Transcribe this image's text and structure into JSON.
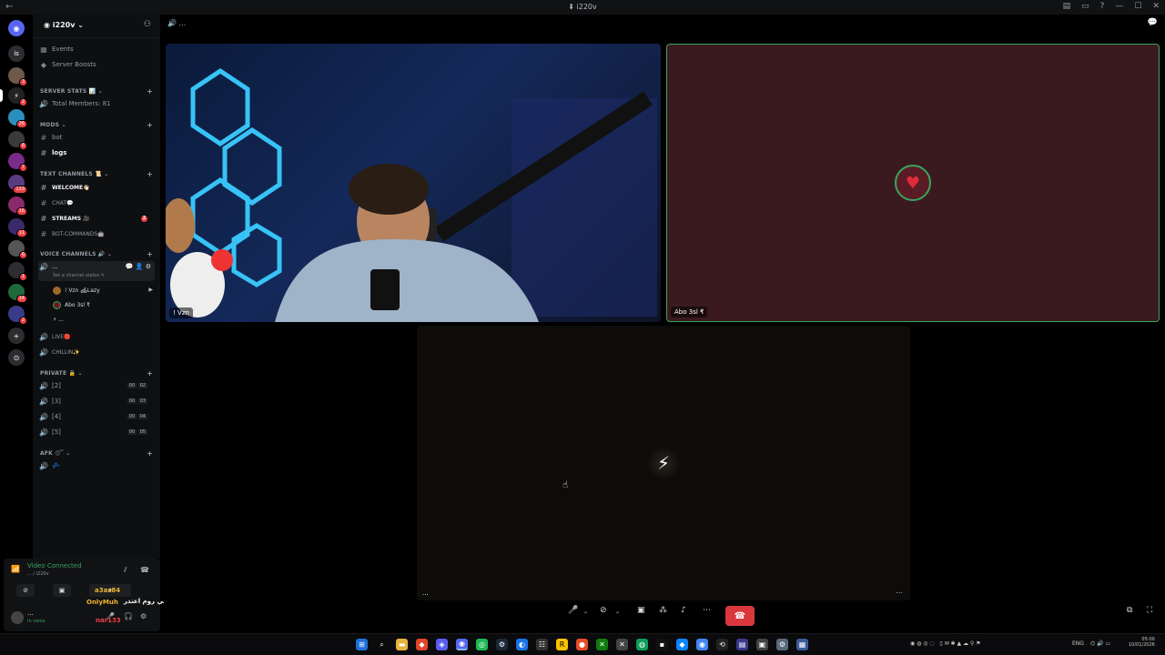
{
  "window": {
    "title": "i220v"
  },
  "guild": {
    "name": "i220v"
  },
  "sidebar": {
    "top_items": [
      {
        "label": "Events",
        "icon": "calendar-icon"
      },
      {
        "label": "Server Boosts",
        "icon": "boost-icon"
      }
    ],
    "cat_server_stats": "SERVER STATS 📊",
    "total_members": "Total Members: 81",
    "cat_mods": "MODS",
    "bot": "bot",
    "logs": "logs",
    "cat_text": "TEXT CHANNELS 📜",
    "welcome": "WELCOME👋🏻",
    "chat": "CHAT💬",
    "streams": "STREAMS 🎥",
    "streams_badge": "2",
    "bot_commands": "BOT-COMMANDS🤖",
    "cat_voice": "VOICE CHANNELS 🔊",
    "voice_current": "...",
    "set_status": "Set a channel status",
    "voice_users": [
      "! Vzn 🛋Lazy",
      "Abo 3sl ₹",
      "⚡ ..."
    ],
    "live": "LIVE🔴",
    "chillin": "CHILLIN✨",
    "cat_private": "PRIVATE 🔒",
    "private_rooms": [
      {
        "label": "[2]",
        "count": "00",
        "limit": "02"
      },
      {
        "label": "[3]",
        "count": "00",
        "limit": "03"
      },
      {
        "label": "[4]",
        "count": "00",
        "limit": "04"
      },
      {
        "label": "[5]",
        "count": "00",
        "limit": "05"
      }
    ],
    "cat_afk": "AFK 😴",
    "afk_channel": "💤"
  },
  "voice_panel": {
    "status": "Video Connected",
    "location": "... / i220v",
    "user_name": "...",
    "user_status": "In voice"
  },
  "overlay": {
    "arabic_msg": "خشيت الدس يمالوقت يس ما اقدر الحين اجي روم اعتذر",
    "name1": "OnlyMuh",
    "name2": "a3az84",
    "name3": "nar133"
  },
  "call": {
    "tile1_label": "! Vzn",
    "tile2_label": "Abo 3sl ₹",
    "tile3_label": "...",
    "header": "..."
  },
  "taskbar": {
    "lang": "ENG",
    "time": "05:00",
    "date": "10/01/2026"
  },
  "colors": {
    "accent_green": "#3ba55c",
    "tile2_bg": "#3b1a1f",
    "tile3_bg": "#0d0c0a",
    "end_call": "#da373c"
  }
}
